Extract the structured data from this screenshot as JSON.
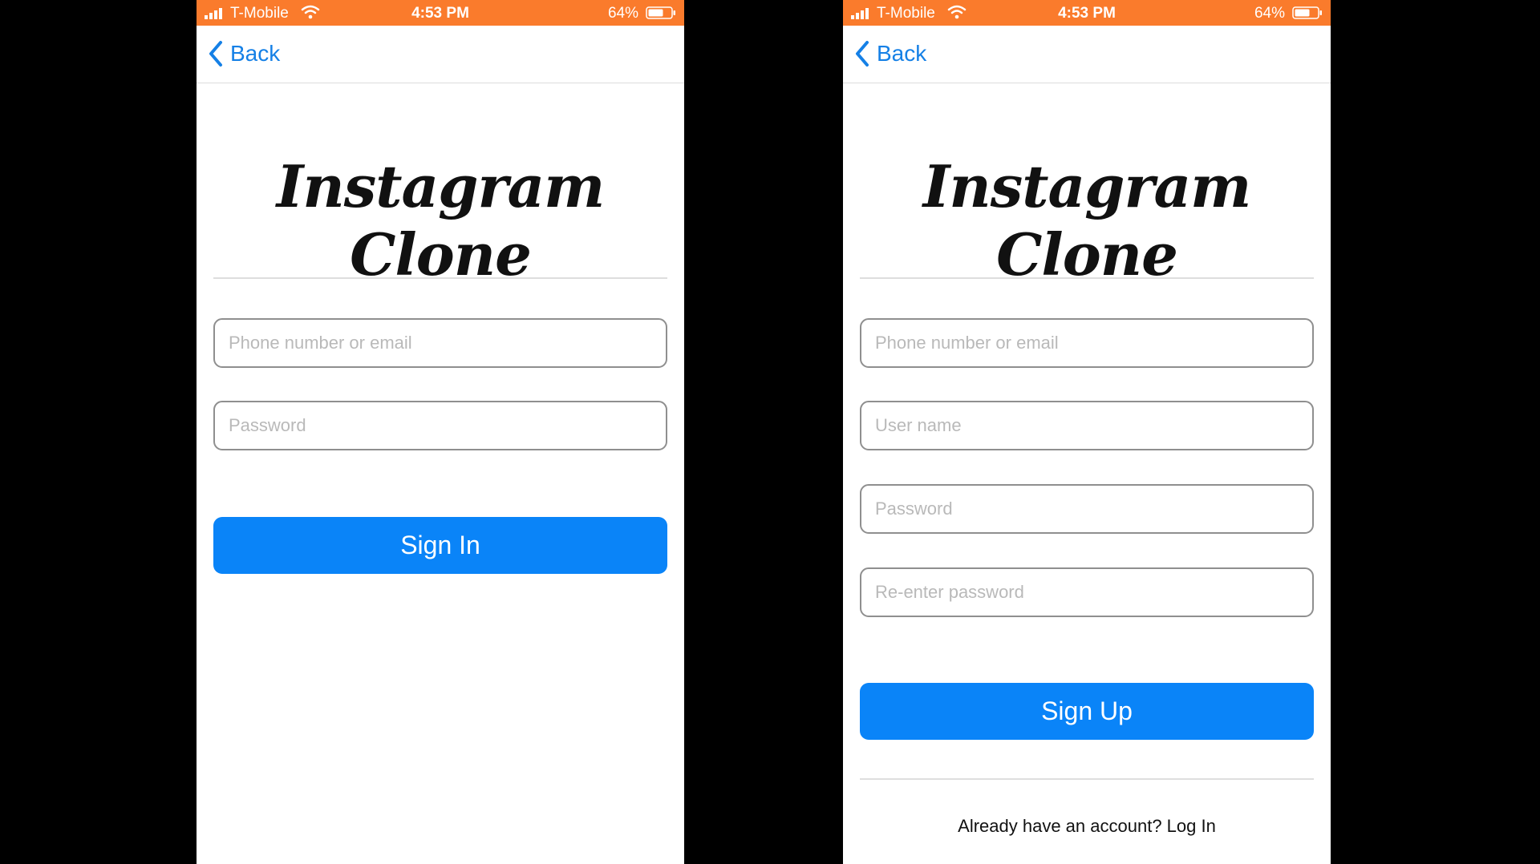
{
  "status_bar": {
    "carrier": "T-Mobile",
    "time": "4:53 PM",
    "battery": "64%"
  },
  "nav": {
    "back_label": "Back"
  },
  "app": {
    "title": "Instagram Clone"
  },
  "sign_in": {
    "email_placeholder": "Phone number or email",
    "password_placeholder": "Password",
    "button_label": "Sign In"
  },
  "sign_up": {
    "email_placeholder": "Phone number or email",
    "username_placeholder": "User name",
    "password_placeholder": "Password",
    "reenter_placeholder": "Re-enter password",
    "button_label": "Sign Up",
    "footer_prompt": "Already have an account? Log In"
  },
  "colors": {
    "status_bar": "#fa7b2c",
    "accent": "#0a84f8",
    "link": "#1580e6",
    "background": "#000000"
  },
  "icons": [
    "cellular-signal-icon",
    "wifi-icon",
    "battery-icon",
    "chevron-left-icon"
  ]
}
